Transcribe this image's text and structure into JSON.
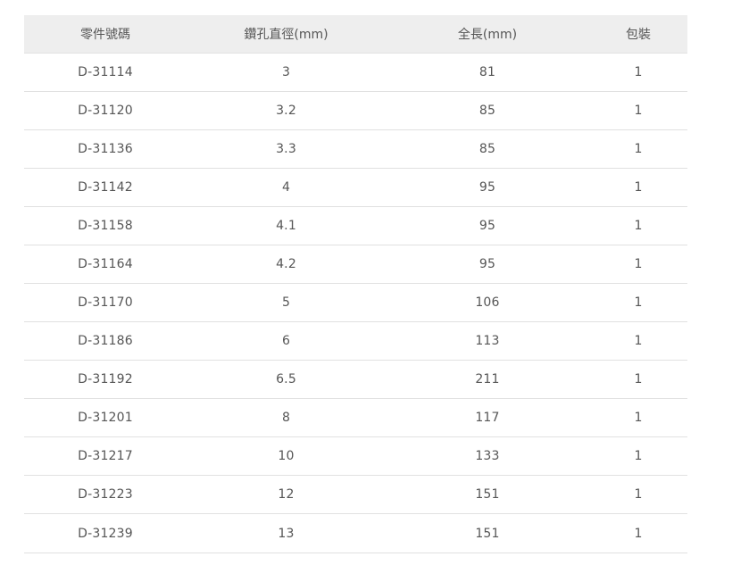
{
  "table": {
    "headers": [
      "零件號碼",
      "鑽孔直徑(mm)",
      "全長(mm)",
      "包裝"
    ],
    "rows": [
      [
        "D-31114",
        "3",
        "81",
        "1"
      ],
      [
        "D-31120",
        "3.2",
        "85",
        "1"
      ],
      [
        "D-31136",
        "3.3",
        "85",
        "1"
      ],
      [
        "D-31142",
        "4",
        "95",
        "1"
      ],
      [
        "D-31158",
        "4.1",
        "95",
        "1"
      ],
      [
        "D-31164",
        "4.2",
        "95",
        "1"
      ],
      [
        "D-31170",
        "5",
        "106",
        "1"
      ],
      [
        "D-31186",
        "6",
        "113",
        "1"
      ],
      [
        "D-31192",
        "6.5",
        "211",
        "1"
      ],
      [
        "D-31201",
        "8",
        "117",
        "1"
      ],
      [
        "D-31217",
        "10",
        "133",
        "1"
      ],
      [
        "D-31223",
        "12",
        "151",
        "1"
      ],
      [
        "D-31239",
        "13",
        "151",
        "1"
      ]
    ]
  },
  "colors": {
    "header_background": "#eeeeee",
    "text": "#555555",
    "row_divider": "#e1e1e1"
  }
}
